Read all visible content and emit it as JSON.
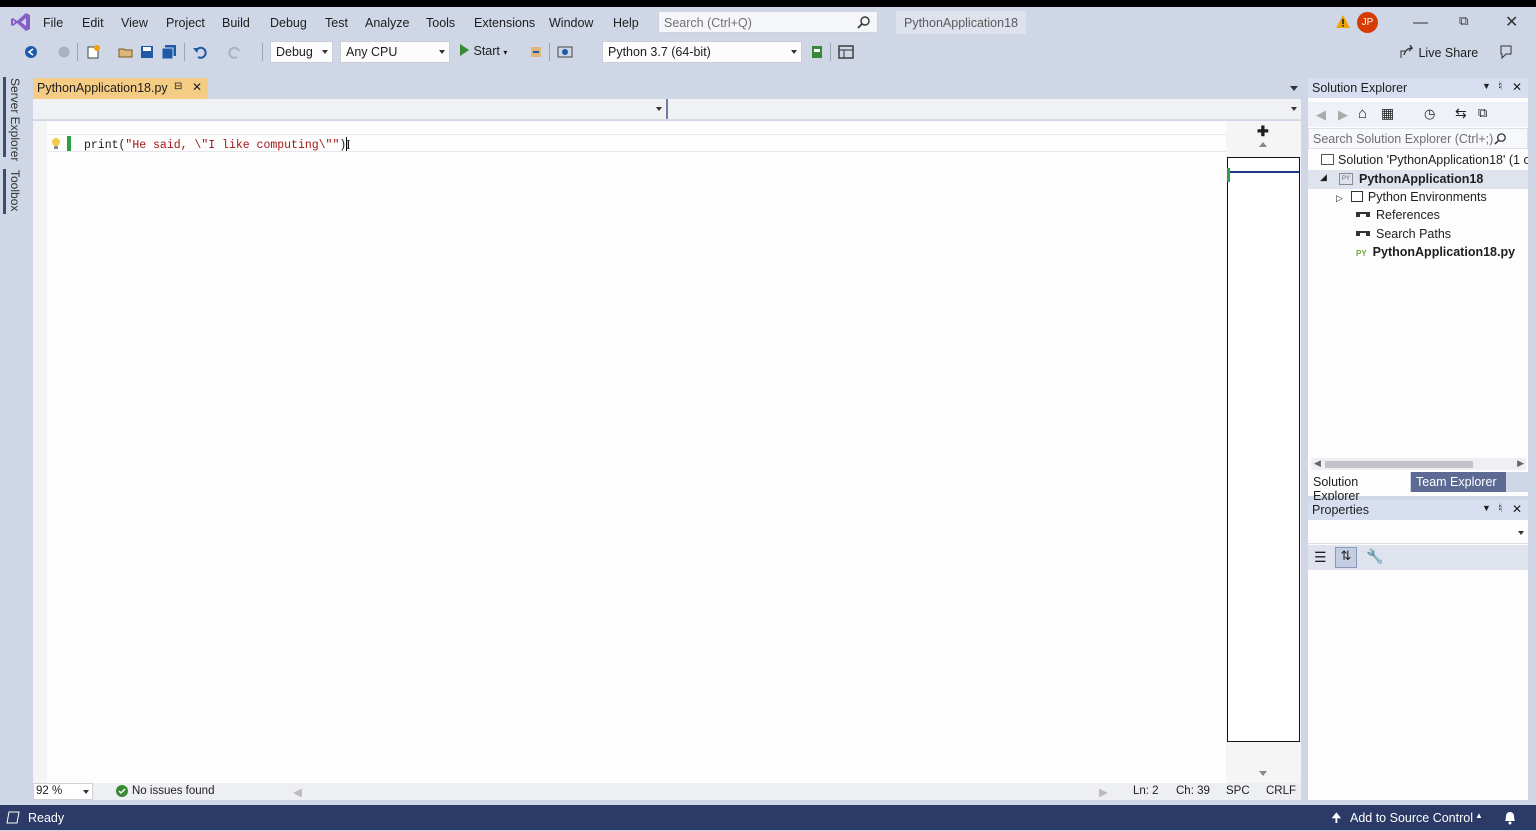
{
  "menu": {
    "items": [
      "File",
      "Edit",
      "View",
      "Project",
      "Build",
      "Debug",
      "Test",
      "Analyze",
      "Tools",
      "Extensions",
      "Window",
      "Help"
    ],
    "search_placeholder": "Search (Ctrl+Q)",
    "solution_name": "PythonApplication18",
    "user_initials": "JP"
  },
  "toolbar": {
    "config": "Debug",
    "platform": "Any CPU",
    "start_label": "Start",
    "environment": "Python 3.7 (64-bit)",
    "live_share": "Live Share"
  },
  "left_rail": {
    "server_explorer": "Server Explorer",
    "toolbox": "Toolbox"
  },
  "editor": {
    "tab_name": "PythonApplication18.py",
    "code_fn": "print",
    "code_open": "(",
    "code_string": "\"He said, \\\"I like computing\\\"\"",
    "code_close": ")"
  },
  "editor_status": {
    "zoom": "92 %",
    "issues": "No issues found",
    "line": "Ln: 2",
    "col": "Ch: 39",
    "spacing": "SPC",
    "line_ending": "CRLF"
  },
  "solution_explorer": {
    "title": "Solution Explorer",
    "search_placeholder": "Search Solution Explorer (Ctrl+;)",
    "solution_node": "Solution 'PythonApplication18' (1 o",
    "project_node": "PythonApplication18",
    "children": [
      "Python Environments",
      "References",
      "Search Paths"
    ],
    "file_node": "PythonApplication18.py",
    "tabs": [
      "Solution Explorer",
      "Team Explorer"
    ]
  },
  "properties": {
    "title": "Properties"
  },
  "statusbar": {
    "ready": "Ready",
    "source_control": "Add to Source Control"
  },
  "colors": {
    "accent": "#2b3a66",
    "chrome": "#cfd6e5",
    "tab_active": "#f5cc84",
    "string": "#a31515",
    "vs_purple": "#865fc5"
  }
}
